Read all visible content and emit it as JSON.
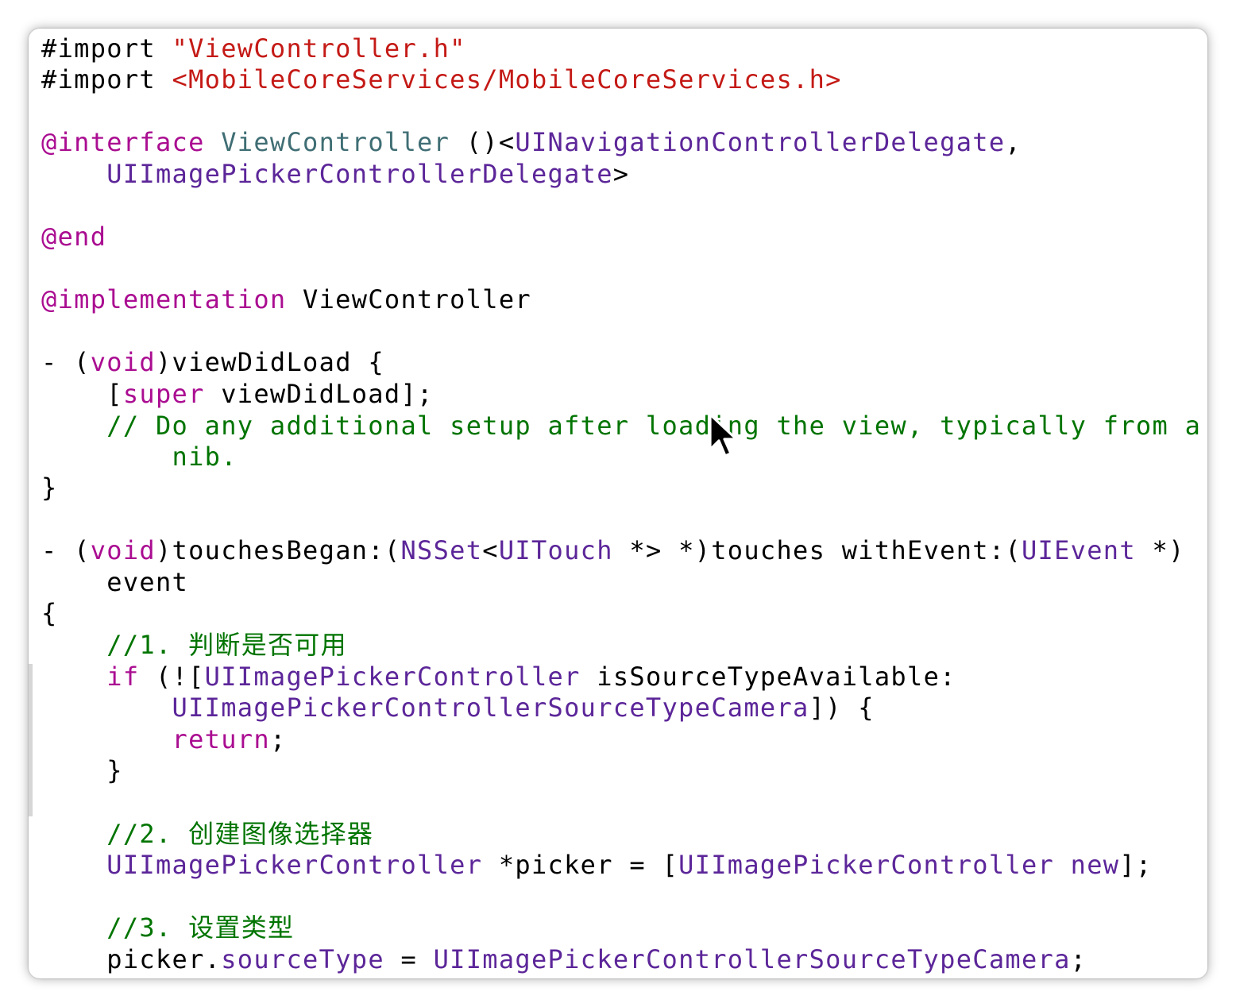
{
  "editor": {
    "lines": [
      {
        "segments": [
          {
            "t": "#import ",
            "c": "pl"
          },
          {
            "t": "\"ViewController.h\"",
            "c": "str"
          }
        ]
      },
      {
        "segments": [
          {
            "t": "#import ",
            "c": "pl"
          },
          {
            "t": "<MobileCoreServices/MobileCoreServices.h>",
            "c": "str"
          }
        ]
      },
      {
        "segments": [
          {
            "t": "@interface ",
            "c": "kw"
          },
          {
            "t": "ViewController",
            "c": "cls"
          },
          {
            "t": " ()<",
            "c": "pl"
          },
          {
            "t": "UINavigationControllerDelegate",
            "c": "tp"
          },
          {
            "t": ",",
            "c": "pl"
          }
        ]
      },
      {
        "segments": [
          {
            "t": "    UIImagePickerControllerDelegate",
            "c": "tp"
          },
          {
            "t": ">",
            "c": "pl"
          }
        ]
      },
      {
        "segments": [
          {
            "t": "@end",
            "c": "kw"
          }
        ]
      },
      {
        "segments": [
          {
            "t": "@implementation",
            "c": "kw"
          },
          {
            "t": " ViewController",
            "c": "pl"
          }
        ]
      },
      {
        "segments": [
          {
            "t": "- (",
            "c": "pl"
          },
          {
            "t": "void",
            "c": "kw"
          },
          {
            "t": ")viewDidLoad {",
            "c": "pl"
          }
        ]
      },
      {
        "segments": [
          {
            "t": "    [",
            "c": "pl"
          },
          {
            "t": "super",
            "c": "kw"
          },
          {
            "t": " viewDidLoad];",
            "c": "pl"
          }
        ]
      },
      {
        "segments": [
          {
            "t": "    // Do any additional setup after loading the view, typically from a",
            "c": "cm"
          }
        ]
      },
      {
        "segments": [
          {
            "t": "        nib.",
            "c": "cm"
          }
        ]
      },
      {
        "segments": [
          {
            "t": "}",
            "c": "pl"
          }
        ]
      },
      {
        "segments": [
          {
            "t": "- (",
            "c": "pl"
          },
          {
            "t": "void",
            "c": "kw"
          },
          {
            "t": ")touchesBegan:(",
            "c": "pl"
          },
          {
            "t": "NSSet",
            "c": "tp"
          },
          {
            "t": "<",
            "c": "pl"
          },
          {
            "t": "UITouch",
            "c": "tp"
          },
          {
            "t": " *> *)touches withEvent:(",
            "c": "pl"
          },
          {
            "t": "UIEvent",
            "c": "tp"
          },
          {
            "t": " *)",
            "c": "pl"
          }
        ]
      },
      {
        "segments": [
          {
            "t": "    event",
            "c": "pl"
          }
        ]
      },
      {
        "segments": [
          {
            "t": "{",
            "c": "pl"
          }
        ]
      },
      {
        "segments": [
          {
            "t": "    //1. 判断是否可用",
            "c": "cm"
          }
        ]
      },
      {
        "segments": [
          {
            "t": "    ",
            "c": "pl"
          },
          {
            "t": "if",
            "c": "kw"
          },
          {
            "t": " (![",
            "c": "pl"
          },
          {
            "t": "UIImagePickerController",
            "c": "tp"
          },
          {
            "t": " isSourceTypeAvailable:",
            "c": "pl"
          }
        ]
      },
      {
        "segments": [
          {
            "t": "        UIImagePickerControllerSourceTypeCamera",
            "c": "tp"
          },
          {
            "t": "]) {",
            "c": "pl"
          }
        ]
      },
      {
        "segments": [
          {
            "t": "        ",
            "c": "pl"
          },
          {
            "t": "return",
            "c": "kw"
          },
          {
            "t": ";",
            "c": "pl"
          }
        ]
      },
      {
        "segments": [
          {
            "t": "    }",
            "c": "pl"
          }
        ]
      },
      {
        "segments": [
          {
            "t": "    //2. 创建图像选择器",
            "c": "cm"
          }
        ]
      },
      {
        "segments": [
          {
            "t": "    UIImagePickerController",
            "c": "tp"
          },
          {
            "t": " *picker = [",
            "c": "pl"
          },
          {
            "t": "UIImagePickerController",
            "c": "tp"
          },
          {
            "t": " new",
            "c": "tp"
          },
          {
            "t": "];",
            "c": "pl"
          }
        ]
      },
      {
        "segments": [
          {
            "t": "    //3. 设置类型",
            "c": "cm"
          }
        ]
      },
      {
        "segments": [
          {
            "t": "    picker.",
            "c": "pl"
          },
          {
            "t": "sourceType",
            "c": "tp"
          },
          {
            "t": " = ",
            "c": "pl"
          },
          {
            "t": "UIImagePickerControllerSourceTypeCamera",
            "c": "tp"
          },
          {
            "t": ";",
            "c": "pl"
          }
        ]
      }
    ]
  },
  "colors": {
    "keyword": "#aa0d91",
    "string": "#c41a16",
    "class": "#3f6e74",
    "type": "#5c2699",
    "comment": "#007400",
    "plain": "#000000"
  },
  "cursor": {
    "icon": "arrow-cursor-icon"
  }
}
